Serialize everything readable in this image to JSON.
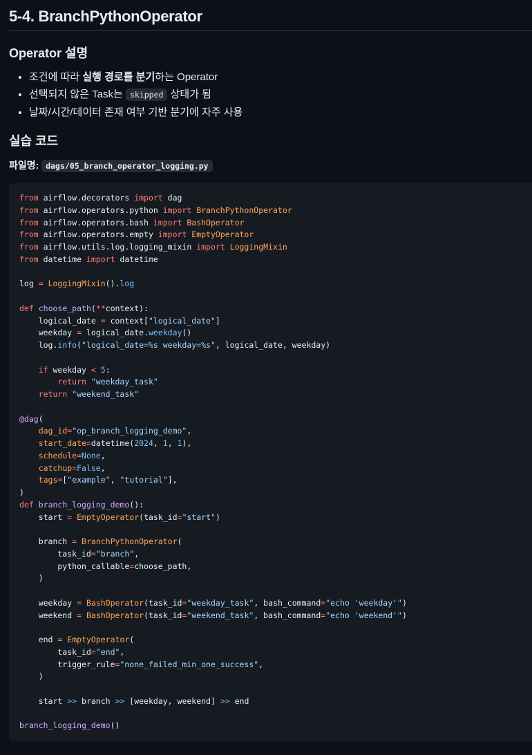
{
  "title": "5-4. BranchPythonOperator",
  "section1": {
    "heading": "Operator 설명",
    "bullets": [
      {
        "pre": "조건에 따라 ",
        "bold": "실행 경로를 분기",
        "post": "하는 Operator"
      },
      {
        "pre": "선택되지 않은 Task는 ",
        "code": "skipped",
        "post": " 상태가 됨"
      },
      {
        "text": "날짜/시간/데이터 존재 여부 기반 분기에 자주 사용"
      }
    ]
  },
  "section2": {
    "heading": "실습 코드",
    "file_label": "파일명",
    "file_sep": ":",
    "file_name": "dags/05_branch_operator_logging.py"
  },
  "code_lines": [
    [
      [
        "from",
        "k"
      ],
      [
        " airflow.decorators ",
        ""
      ],
      [
        "import",
        "k"
      ],
      [
        " dag",
        ""
      ]
    ],
    [
      [
        "from",
        "k"
      ],
      [
        " airflow.operators.python ",
        ""
      ],
      [
        "import",
        "k"
      ],
      [
        " BranchPythonOperator",
        "o"
      ]
    ],
    [
      [
        "from",
        "k"
      ],
      [
        " airflow.operators.bash ",
        ""
      ],
      [
        "import",
        "k"
      ],
      [
        " BashOperator",
        "o"
      ]
    ],
    [
      [
        "from",
        "k"
      ],
      [
        " airflow.operators.empty ",
        ""
      ],
      [
        "import",
        "k"
      ],
      [
        " EmptyOperator",
        "o"
      ]
    ],
    [
      [
        "from",
        "k"
      ],
      [
        " airflow.utils.log.logging_mixin ",
        ""
      ],
      [
        "import",
        "k"
      ],
      [
        " LoggingMixin",
        "o"
      ]
    ],
    [
      [
        "from",
        "k"
      ],
      [
        " datetime ",
        ""
      ],
      [
        "import",
        "k"
      ],
      [
        " datetime",
        ""
      ]
    ],
    [],
    [
      [
        "log ",
        ""
      ],
      [
        "=",
        "k"
      ],
      [
        " ",
        ""
      ],
      [
        "LoggingMixin",
        "o"
      ],
      [
        "().",
        ""
      ],
      [
        "log",
        "c"
      ]
    ],
    [],
    [
      [
        "def",
        "k"
      ],
      [
        " ",
        ""
      ],
      [
        "choose_path",
        "f"
      ],
      [
        "(",
        ""
      ],
      [
        "**",
        "k"
      ],
      [
        "context):",
        ""
      ]
    ],
    [
      [
        "    logical_date ",
        ""
      ],
      [
        "=",
        "k"
      ],
      [
        " context[",
        ""
      ],
      [
        "\"logical_date\"",
        "s"
      ],
      [
        "]",
        ""
      ]
    ],
    [
      [
        "    weekday ",
        ""
      ],
      [
        "=",
        "k"
      ],
      [
        " logical_date.",
        ""
      ],
      [
        "weekday",
        "c"
      ],
      [
        "()",
        ""
      ]
    ],
    [
      [
        "    log.",
        ""
      ],
      [
        "info",
        "c"
      ],
      [
        "(",
        ""
      ],
      [
        "\"logical_date=%s weekday=%s\"",
        "s"
      ],
      [
        ", logical_date, weekday)",
        ""
      ]
    ],
    [],
    [
      [
        "    ",
        ""
      ],
      [
        "if",
        "k"
      ],
      [
        " weekday ",
        ""
      ],
      [
        "<",
        "k"
      ],
      [
        " ",
        ""
      ],
      [
        "5",
        "c"
      ],
      [
        ":",
        ""
      ]
    ],
    [
      [
        "        ",
        ""
      ],
      [
        "return",
        "k"
      ],
      [
        " ",
        ""
      ],
      [
        "\"weekday_task\"",
        "s"
      ]
    ],
    [
      [
        "    ",
        ""
      ],
      [
        "return",
        "k"
      ],
      [
        " ",
        ""
      ],
      [
        "\"weekend_task\"",
        "s"
      ]
    ],
    [],
    [
      [
        "@dag",
        "f"
      ],
      [
        "(",
        ""
      ]
    ],
    [
      [
        "    ",
        ""
      ],
      [
        "dag_id",
        "o"
      ],
      [
        "=",
        "k"
      ],
      [
        "\"op_branch_logging_demo\"",
        "s"
      ],
      [
        ",",
        ""
      ]
    ],
    [
      [
        "    ",
        ""
      ],
      [
        "start_date",
        "o"
      ],
      [
        "=",
        "k"
      ],
      [
        "datetime(",
        ""
      ],
      [
        "2024",
        "c"
      ],
      [
        ", ",
        ""
      ],
      [
        "1",
        "c"
      ],
      [
        ", ",
        ""
      ],
      [
        "1",
        "c"
      ],
      [
        "),",
        ""
      ]
    ],
    [
      [
        "    ",
        ""
      ],
      [
        "schedule",
        "o"
      ],
      [
        "=",
        "k"
      ],
      [
        "None",
        "c"
      ],
      [
        ",",
        ""
      ]
    ],
    [
      [
        "    ",
        ""
      ],
      [
        "catchup",
        "o"
      ],
      [
        "=",
        "k"
      ],
      [
        "False",
        "c"
      ],
      [
        ",",
        ""
      ]
    ],
    [
      [
        "    ",
        ""
      ],
      [
        "tags",
        "o"
      ],
      [
        "=",
        "k"
      ],
      [
        "[",
        ""
      ],
      [
        "\"example\"",
        "s"
      ],
      [
        ", ",
        ""
      ],
      [
        "\"tutorial\"",
        "s"
      ],
      [
        "],",
        ""
      ]
    ],
    [
      [
        ")",
        ""
      ]
    ],
    [
      [
        "def",
        "k"
      ],
      [
        " ",
        ""
      ],
      [
        "branch_logging_demo",
        "f"
      ],
      [
        "():",
        ""
      ]
    ],
    [
      [
        "    start ",
        ""
      ],
      [
        "=",
        "k"
      ],
      [
        " ",
        ""
      ],
      [
        "EmptyOperator",
        "o"
      ],
      [
        "(task_id",
        ""
      ],
      [
        "=",
        "k"
      ],
      [
        "\"start\"",
        "s"
      ],
      [
        ")",
        ""
      ]
    ],
    [],
    [
      [
        "    branch ",
        ""
      ],
      [
        "=",
        "k"
      ],
      [
        " ",
        ""
      ],
      [
        "BranchPythonOperator",
        "o"
      ],
      [
        "(",
        ""
      ]
    ],
    [
      [
        "        task_id",
        ""
      ],
      [
        "=",
        "k"
      ],
      [
        "\"branch\"",
        "s"
      ],
      [
        ",",
        ""
      ]
    ],
    [
      [
        "        python_callable",
        ""
      ],
      [
        "=",
        "k"
      ],
      [
        "choose_path,",
        ""
      ]
    ],
    [
      [
        "    )",
        ""
      ]
    ],
    [],
    [
      [
        "    weekday ",
        ""
      ],
      [
        "=",
        "k"
      ],
      [
        " ",
        ""
      ],
      [
        "BashOperator",
        "o"
      ],
      [
        "(task_id",
        ""
      ],
      [
        "=",
        "k"
      ],
      [
        "\"weekday_task\"",
        "s"
      ],
      [
        ", bash_command",
        ""
      ],
      [
        "=",
        "k"
      ],
      [
        "\"echo 'weekday'\"",
        "s"
      ],
      [
        ")",
        ""
      ]
    ],
    [
      [
        "    weekend ",
        ""
      ],
      [
        "=",
        "k"
      ],
      [
        " ",
        ""
      ],
      [
        "BashOperator",
        "o"
      ],
      [
        "(task_id",
        ""
      ],
      [
        "=",
        "k"
      ],
      [
        "\"weekend_task\"",
        "s"
      ],
      [
        ", bash_command",
        ""
      ],
      [
        "=",
        "k"
      ],
      [
        "\"echo 'weekend'\"",
        "s"
      ],
      [
        ")",
        ""
      ]
    ],
    [],
    [
      [
        "    end ",
        ""
      ],
      [
        "=",
        "k"
      ],
      [
        " ",
        ""
      ],
      [
        "EmptyOperator",
        "o"
      ],
      [
        "(",
        ""
      ]
    ],
    [
      [
        "        task_id",
        ""
      ],
      [
        "=",
        "k"
      ],
      [
        "\"end\"",
        "s"
      ],
      [
        ",",
        ""
      ]
    ],
    [
      [
        "        trigger_rule",
        ""
      ],
      [
        "=",
        "k"
      ],
      [
        "\"none_failed_min_one_success\"",
        "s"
      ],
      [
        ",",
        ""
      ]
    ],
    [
      [
        "    )",
        ""
      ]
    ],
    [],
    [
      [
        "    start ",
        ""
      ],
      [
        ">>",
        "c"
      ],
      [
        " branch ",
        ""
      ],
      [
        ">>",
        "c"
      ],
      [
        " [weekday, weekend] ",
        ""
      ],
      [
        ">>",
        "c"
      ],
      [
        " end",
        ""
      ]
    ],
    [],
    [
      [
        "branch_logging_demo",
        "f"
      ],
      [
        "()",
        ""
      ]
    ]
  ],
  "colors": {
    "background": "#0d1117",
    "code_bg": "#161b22",
    "keyword": "#ff7b72",
    "string": "#a5d6ff",
    "function": "#d2a8ff",
    "constant": "#79c0ff",
    "class": "#ffa657"
  }
}
